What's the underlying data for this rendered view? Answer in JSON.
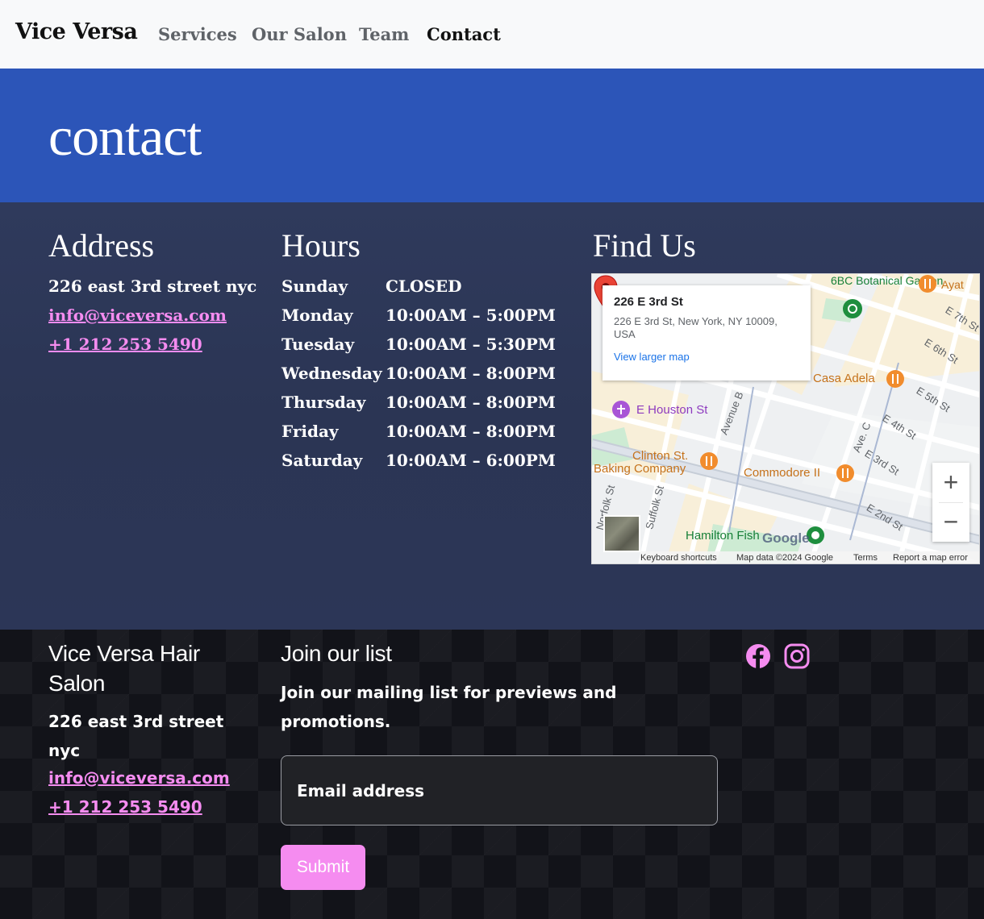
{
  "nav": {
    "brand": "Vice Versa",
    "links": [
      "Services",
      "Our Salon",
      "Team",
      "Contact"
    ],
    "active": "Contact"
  },
  "hero": {
    "title": "contact"
  },
  "address": {
    "heading": "Address",
    "street": "226 east 3rd street nyc",
    "email": "info@viceversa.com",
    "phone": "+1 212 253 5490"
  },
  "hours": {
    "heading": "Hours",
    "rows": [
      {
        "day": "Sunday",
        "time": "CLOSED"
      },
      {
        "day": "Monday",
        "time": "10:00AM – 5:00PM"
      },
      {
        "day": "Tuesday",
        "time": "10:00AM – 5:30PM"
      },
      {
        "day": "Wednesday",
        "time": "10:00AM – 8:00PM"
      },
      {
        "day": "Thursday",
        "time": "10:00AM – 8:00PM"
      },
      {
        "day": "Friday",
        "time": "10:00AM – 8:00PM"
      },
      {
        "day": "Saturday",
        "time": "10:00AM – 6:00PM"
      }
    ]
  },
  "find_us": {
    "heading": "Find Us",
    "map": {
      "card_title": "226 E 3rd St",
      "card_address": "226 E 3rd St, New York, NY 10009, USA",
      "card_link": "View larger map",
      "labels": {
        "botanical": "6BC Botanical Garden",
        "ayat": "Ayat",
        "casa": "Casa Adela",
        "houston": "E Houston St",
        "clinton": "Clinton St.",
        "baking": "Baking Company",
        "commodore": "Commodore II",
        "hamilton": "Hamilton Fish",
        "e7": "E 7th St",
        "e6": "E 6th St",
        "e5": "E 5th St",
        "e4": "E 4th St",
        "e3": "E 3rd St",
        "e2": "E 2nd St",
        "aveb": "Avenue B",
        "avec": "Ave. C",
        "norfolk": "Norfolk St",
        "suffolk": "Suffolk St"
      },
      "google": "Google",
      "zoom_in": "+",
      "zoom_out": "−",
      "footer": {
        "shortcuts": "Keyboard shortcuts",
        "data": "Map data ©2024 Google",
        "terms": "Terms",
        "report": "Report a map error"
      }
    }
  },
  "footer": {
    "salon_name": "Vice Versa Hair Salon",
    "street": "226 east 3rd street nyc",
    "email": "info@viceversa.com",
    "phone": "+1 212 253 5490",
    "join_heading": "Join our list",
    "join_text": "Join our mailing list for previews and promotions.",
    "email_placeholder": "Email address",
    "submit": "Submit",
    "social": [
      "facebook-icon",
      "instagram-icon"
    ]
  },
  "colors": {
    "hero_blue": "#2c55b8",
    "section_navy": "#2f3a5c",
    "pink": "#f58cf0",
    "footer_dark": "#121319"
  }
}
